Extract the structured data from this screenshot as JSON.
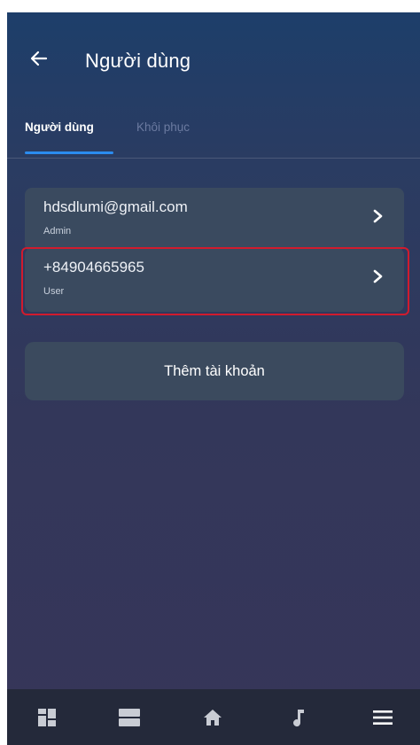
{
  "header": {
    "title": "Người dùng"
  },
  "tabs": [
    {
      "label": "Người dùng",
      "active": true
    },
    {
      "label": "Khôi phục",
      "active": false
    }
  ],
  "users": [
    {
      "email": "hdsdlumi@gmail.com",
      "role": "Admin"
    },
    {
      "email": "+84904665965",
      "role": "User",
      "highlighted": true
    }
  ],
  "add_account_label": "Thêm tài khoản",
  "bottom_nav": [
    {
      "icon": "dashboard-icon"
    },
    {
      "icon": "rooms-icon"
    },
    {
      "icon": "home-icon"
    },
    {
      "icon": "music-icon"
    },
    {
      "icon": "menu-icon"
    }
  ],
  "colors": {
    "accent": "#2b8cf0",
    "highlight": "#d11b2d",
    "card": "#3a4a5f"
  }
}
